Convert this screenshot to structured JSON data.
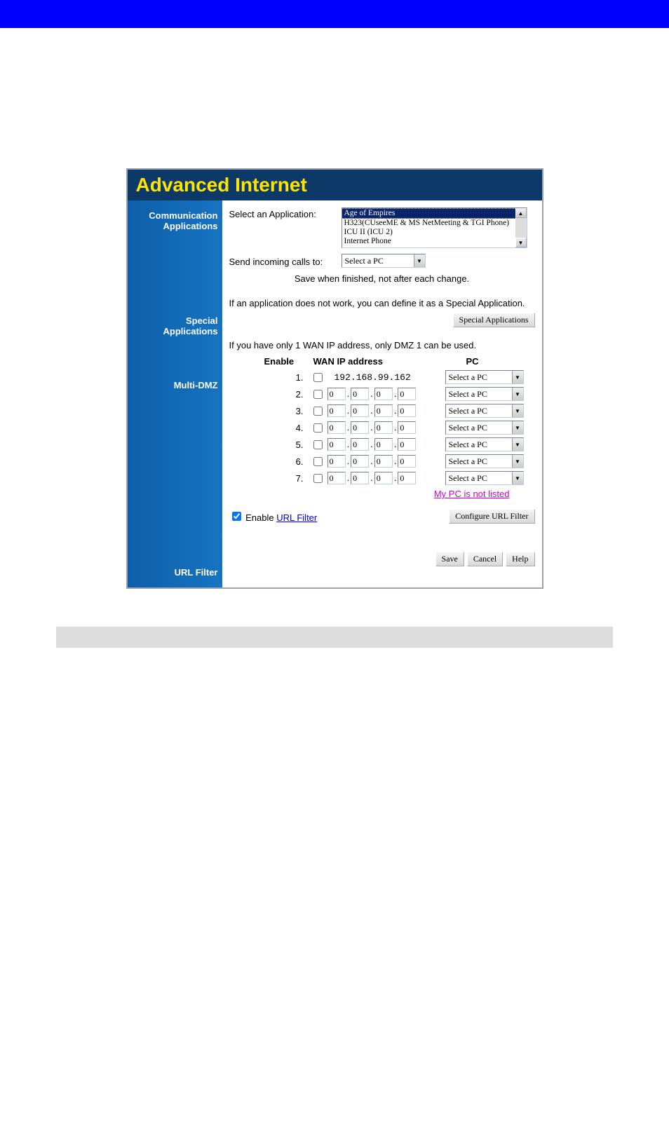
{
  "header": {
    "title": "Advanced Internet"
  },
  "sidebar": {
    "comm1": "Communication",
    "comm2": "Applications",
    "spec1": "Special",
    "spec2": "Applications",
    "multi": "Multi-DMZ",
    "url": "URL Filter"
  },
  "comm": {
    "select_app_label": "Select an Application:",
    "apps": {
      "selected": "Age of Empires",
      "item1": "H323(CUseeME & MS NetMeeting & TGI Phone)",
      "item2": "ICU II (ICU 2)",
      "item3": "Internet Phone"
    },
    "send_label": "Send incoming calls to:",
    "send_value": "Select a PC",
    "note": "Save when finished, not after each change."
  },
  "special": {
    "text": "If an application does not work, you can define it as a Special Application.",
    "button": "Special Applications"
  },
  "dmz": {
    "text": "If you have only 1 WAN IP address, only DMZ 1 can be used.",
    "head_enable": "Enable",
    "head_wan": "WAN IP address",
    "head_pc": "PC",
    "static_ip": "192.168.99.162",
    "pc_default": "Select a PC",
    "rows": {
      "1": "1.",
      "2": "2.",
      "3": "3.",
      "4": "4.",
      "5": "5.",
      "6": "6.",
      "7": "7."
    },
    "zero": "0",
    "not_listed": "My PC is not listed"
  },
  "urlfilter": {
    "enable_label": "Enable ",
    "link": "URL Filter",
    "button": "Configure URL Filter"
  },
  "buttons": {
    "save": "Save",
    "cancel": "Cancel",
    "help": "Help"
  }
}
